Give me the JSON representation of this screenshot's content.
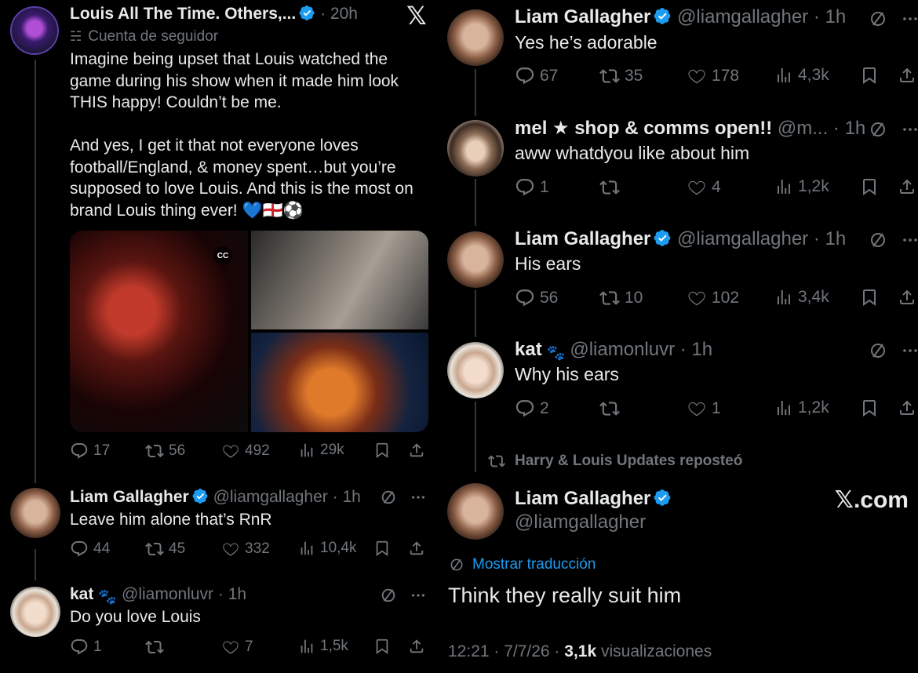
{
  "x_logo": "𝕏",
  "xcom_watermark": "𝕏.com",
  "left": {
    "main_post": {
      "name": "Louis All The Time. Others,...",
      "time": "· 20h",
      "follower_label": "Cuenta de seguidor",
      "text": "Imagine being upset that Louis watched the\ngame during his show when it made him look\nTHIS happy! Couldn’t be me.\n\nAnd yes, I get it that not everyone loves\nfootball/England, & money spent…but you’re\nsupposed to love Louis. And this is the most on\nbrand Louis thing ever! 💙🏴󠁧󠁢󠁥󠁮󠁧󠁿⚽",
      "cc_label": "CC",
      "replies": "17",
      "reposts": "56",
      "likes": "492",
      "views": "29k"
    },
    "reply1": {
      "name": "Liam Gallagher",
      "handle": "@liamgallagher · 1h",
      "text": "Leave him alone that’s RnR",
      "replies": "44",
      "reposts": "45",
      "likes": "332",
      "views": "10,4k"
    },
    "reply2": {
      "name": "kat",
      "handle": "@liamonluvr · 1h",
      "text": "Do you love Louis",
      "replies": "1",
      "reposts": "",
      "likes": "7",
      "views": "1,5k"
    }
  },
  "right": {
    "post1": {
      "name": "Liam Gallagher",
      "handle": "@liamgallagher · 1h",
      "text": "Yes he’s adorable",
      "replies": "67",
      "reposts": "35",
      "likes": "178",
      "views": "4,3k"
    },
    "post2": {
      "name": "mel ★ shop & comms open!!",
      "handle": "@m... · 1h",
      "text": "aww whatdyou like about him",
      "replies": "1",
      "reposts": "",
      "likes": "4",
      "views": "1,2k"
    },
    "post3": {
      "name": "Liam Gallagher",
      "handle": "@liamgallagher · 1h",
      "text": "His ears",
      "replies": "56",
      "reposts": "10",
      "likes": "102",
      "views": "3,4k"
    },
    "post4": {
      "name": "kat",
      "handle": "@liamonluvr · 1h",
      "text": "Why his ears",
      "replies": "2",
      "reposts": "",
      "likes": "1",
      "views": "1,2k"
    },
    "repost_label": "Harry & Louis Updates reposteó",
    "final": {
      "name": "Liam Gallagher",
      "handle": "@liamgallagher",
      "translate": "Mostrar traducción",
      "text": "Think they really suit him",
      "meta_prefix": "12:21 · 7/7/26 · ",
      "meta_views": "3,1k",
      "meta_suffix": " visualizaciones"
    }
  }
}
